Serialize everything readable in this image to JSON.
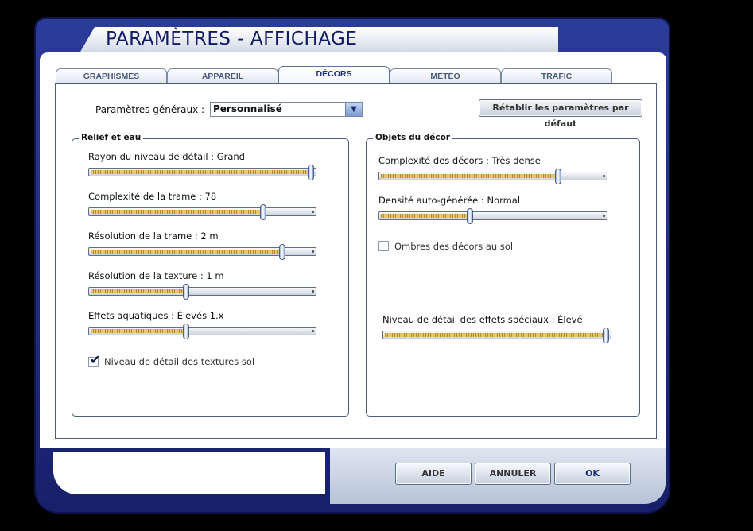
{
  "window": {
    "title": "PARAMÈTRES - AFFICHAGE"
  },
  "tabs": [
    {
      "label": "GRAPHISMES"
    },
    {
      "label": "APPAREIL"
    },
    {
      "label": "DÉCORS",
      "active": true
    },
    {
      "label": "MÉTÉO"
    },
    {
      "label": "TRAFIC"
    }
  ],
  "general": {
    "label": "Paramètres généraux :",
    "selected": "Personnalisé",
    "reset_label": "Rétablir les paramètres par défaut"
  },
  "relief": {
    "title": "Relief et eau",
    "sliders": [
      {
        "label": "Rayon du niveau de détail : Grand",
        "value": 1.0
      },
      {
        "label": "Complexité de la trame : 78",
        "value": 0.78
      },
      {
        "label": "Résolution de la trame : 2 m",
        "value": 0.87
      },
      {
        "label": "Résolution de la texture : 1 m",
        "value": 0.43
      },
      {
        "label": "Effets aquatiques : Élevés 1.x",
        "value": 0.43
      }
    ],
    "checkbox": {
      "label": "Niveau de détail des textures sol",
      "checked": true
    }
  },
  "objects": {
    "title": "Objets du décor",
    "sliders": [
      {
        "label": "Complexité des décors : Très dense",
        "value": 0.8
      },
      {
        "label": "Densité auto-générée : Normal",
        "value": 0.4
      },
      {
        "label": "Niveau de détail des effets spéciaux : Élevé",
        "value": 1.0
      }
    ],
    "checkbox": {
      "label": "Ombres des décors au sol",
      "checked": false
    }
  },
  "buttons": {
    "help": "AIDE",
    "cancel": "ANNULER",
    "ok": "OK"
  },
  "colors": {
    "frame": "#1f2a80",
    "accent": "#d9b24f",
    "tab_active_text": "#1a2e7a"
  }
}
